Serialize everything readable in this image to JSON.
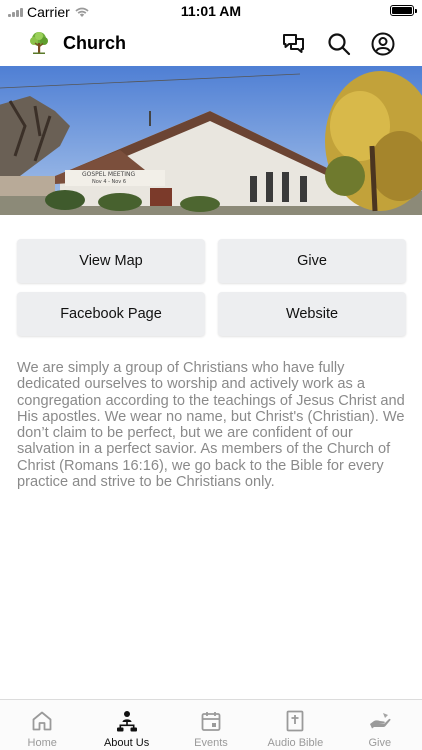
{
  "status": {
    "carrier": "Carrier",
    "time": "11:01 AM"
  },
  "header": {
    "title": "Church",
    "icons": [
      "chat-icon",
      "search-icon",
      "profile-icon"
    ]
  },
  "buttons": {
    "view_map": "View Map",
    "give": "Give",
    "facebook": "Facebook Page",
    "website": "Website"
  },
  "about": {
    "text": "We are simply a group of Christians who have fully dedicated ourselves to worship and actively work as a congregation according to the teachings of Jesus Christ and His apostles.  We wear no name, but Christ's (Christian). We don’t claim to be perfect, but we are confident of our salvation in a perfect savior. As members of the Church of Christ (Romans 16:16), we go back to the Bible for every practice and strive to be Christians only."
  },
  "tabs": [
    {
      "label": "Home",
      "icon": "home-icon",
      "active": false
    },
    {
      "label": "About Us",
      "icon": "people-icon",
      "active": true
    },
    {
      "label": "Events",
      "icon": "calendar-icon",
      "active": false
    },
    {
      "label": "Audio Bible",
      "icon": "bible-icon",
      "active": false
    },
    {
      "label": "Give",
      "icon": "give-hand-icon",
      "active": false
    }
  ],
  "colors": {
    "active_tab": "#111111",
    "inactive_tab": "#9a9a9a",
    "button_bg": "#edeef0",
    "body_text": "#8a8a8a"
  }
}
